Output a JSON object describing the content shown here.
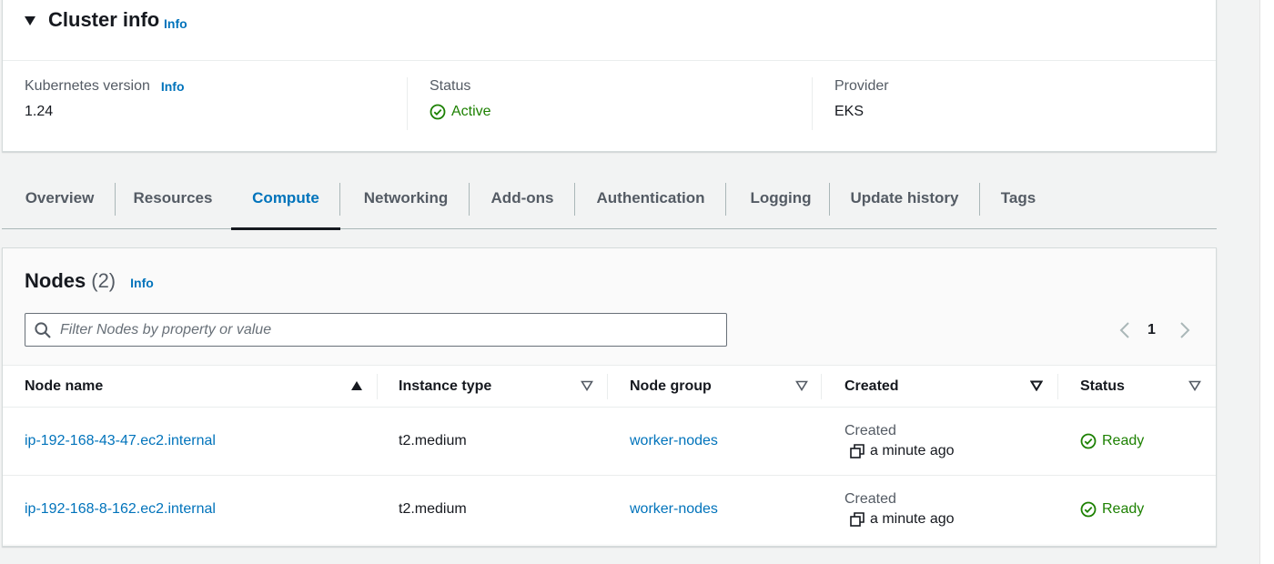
{
  "cluster_info": {
    "title": "Cluster info",
    "info_label": "Info",
    "kubernetes_version": {
      "label": "Kubernetes version",
      "info_label": "Info",
      "value": "1.24"
    },
    "status": {
      "label": "Status",
      "value": "Active"
    },
    "provider": {
      "label": "Provider",
      "value": "EKS"
    }
  },
  "tabs": [
    {
      "label": "Overview",
      "active": false
    },
    {
      "label": "Resources",
      "active": false
    },
    {
      "label": "Compute",
      "active": true
    },
    {
      "label": "Networking",
      "active": false
    },
    {
      "label": "Add-ons",
      "active": false
    },
    {
      "label": "Authentication",
      "active": false
    },
    {
      "label": "Logging",
      "active": false
    },
    {
      "label": "Update history",
      "active": false
    },
    {
      "label": "Tags",
      "active": false
    }
  ],
  "nodes": {
    "title": "Nodes",
    "count": "(2)",
    "info_label": "Info",
    "search_placeholder": "Filter Nodes by property or value",
    "page": "1",
    "columns": [
      {
        "label": "Node name",
        "sort": "ascending"
      },
      {
        "label": "Instance type",
        "sort": "none"
      },
      {
        "label": "Node group",
        "sort": "none"
      },
      {
        "label": "Created",
        "sort": "descending"
      },
      {
        "label": "Status",
        "sort": "none"
      }
    ],
    "rows": [
      {
        "node_name": "ip-192-168-43-47.ec2.internal",
        "instance_type": "t2.medium",
        "node_group": "worker-nodes",
        "created_label": "Created",
        "created": "a minute ago",
        "status": "Ready"
      },
      {
        "node_name": "ip-192-168-8-162.ec2.internal",
        "instance_type": "t2.medium",
        "node_group": "worker-nodes",
        "created_label": "Created",
        "created": "a minute ago",
        "status": "Ready"
      }
    ]
  },
  "colors": {
    "link": "#0073bb",
    "success": "#1d8102",
    "text": "#16191f",
    "secondary_text": "#545b64"
  }
}
